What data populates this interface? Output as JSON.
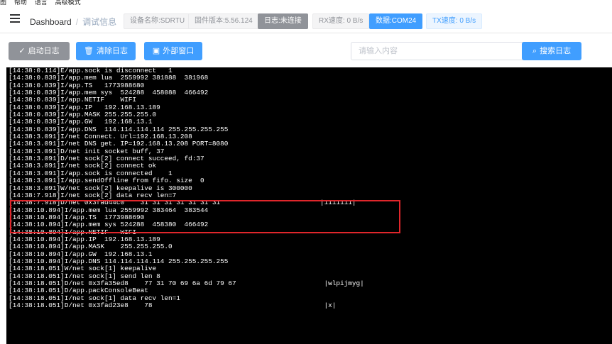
{
  "menu": [
    "图",
    "帮助",
    "语言",
    "高级模式"
  ],
  "header": {
    "breadcrumb_root": "Dashboard",
    "breadcrumb_sep": "/",
    "breadcrumb_current": "调试信息",
    "tags": {
      "device": "设备名称:SDRTU",
      "firmware": "固件版本:5.56.124",
      "log": "日志:未连接",
      "rx": "RX速度: 0 B/s",
      "port": "数据:COM24",
      "tx": "TX速度: 0 B/s"
    }
  },
  "toolbar": {
    "start_label": "启动日志",
    "clear_label": "清除日志",
    "external_label": "外部窗口",
    "search_placeholder": "请输入内容",
    "search_button": "搜索日志"
  },
  "icons": {
    "menu": "hamburger-icon",
    "start": "check-icon",
    "clear": "trash-icon",
    "external": "window-icon",
    "search": "search-icon"
  },
  "colors": {
    "primary": "#409eff",
    "disabled": "#909399",
    "console_bg": "#000000",
    "highlight": "#e0262b"
  },
  "log_lines": [
    "[14:38:0.114]E/app.sock is disconnect   1",
    "[14:38:0.839]I/app.mem lua  2559992 381888  381968",
    "[14:38:0.839]I/app.TS   1773988680",
    "[14:38:0.839]I/app.mem sys  524288  458088  466492",
    "[14:38:0.839]I/app.NETIF    WIFI",
    "[14:38:0.839]I/app.IP   192.168.13.189",
    "[14:38:0.839]I/app.MASK 255.255.255.0",
    "[14:38:0.839]I/app.GW   192.168.13.1",
    "[14:38:0.839]I/app.DNS  114.114.114.114 255.255.255.255",
    "[14:38:3.091]I/net Connect. Url=192.168.13.208",
    "[14:38:3.091]I/net DNS get. IP=192.168.13.208 PORT=8080",
    "[14:38:3.091]D/net init socket buff, 37",
    "[14:38:3.091]D/net sock[2] connect succeed, fd:37",
    "[14:38:3.091]I/net sock[2] connect ok",
    "[14:38:3.091]I/app.sock is connected    1",
    "[14:38:3.091]I/app.sendOffline from fifo. size  0",
    "[14:38:3.091]W/net sock[2] keepalive is 300000",
    "[14:38:7.918]I/net sock[2] data recv len=7",
    "[14:38:7.918]D/net 0x3fad44c0    31 31 31 31 31 31 31                         |1111111|",
    "[14:38:10.894]I/app.mem lua 2559992 383464  383544",
    "[14:38:10.894]I/app.TS  1773988690",
    "[14:38:10.894]I/app.mem sys 524288  458380  466492",
    "[14:38:10.894]I/app.NETIF   WIFI",
    "[14:38:10.894]I/app.IP  192.168.13.189",
    "[14:38:10.894]I/app.MASK    255.255.255.0",
    "[14:38:10.894]I/app.GW  192.168.13.1",
    "[14:38:10.894]I/app.DNS 114.114.114.114 255.255.255.255",
    "[14:38:18.051]W/net sock[1] keepalive",
    "[14:38:18.051]I/net sock[1] send len 8",
    "[14:38:18.051]D/net 0x3fa35ed8    77 31 70 69 6a 6d 79 67                      |wlpijmyg|",
    "[14:38:18.051]D/app.packConsoleBeat",
    "[14:38:18.051]I/net sock[1] data recv len=1",
    "[14:38:18.051]D/net 0x3fad23e8    78                                           |x|"
  ]
}
